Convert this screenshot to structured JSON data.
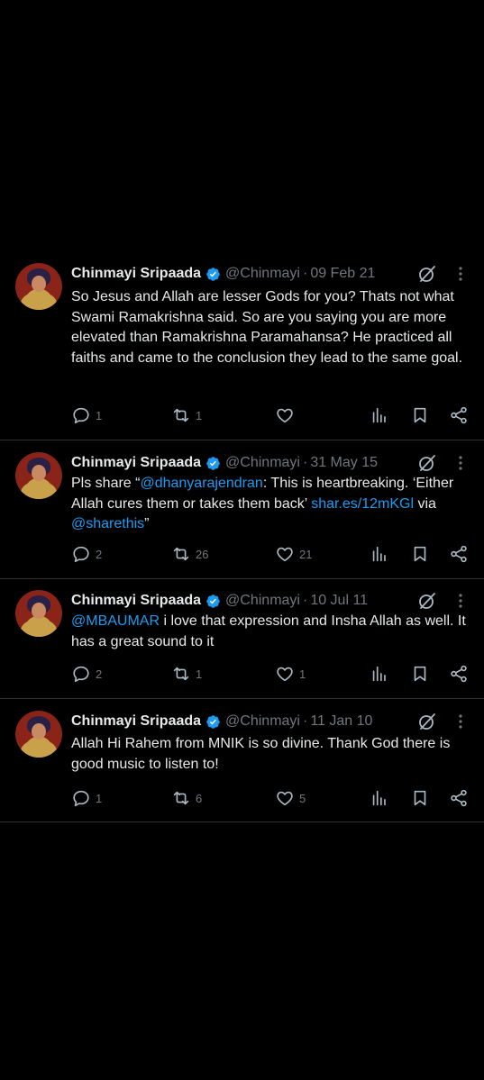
{
  "tweets": [
    {
      "name": "Chinmayi Sripaada",
      "handle": "@Chinmayi",
      "sep": "·",
      "date": "09 Feb 21",
      "text_segments": [
        {
          "t": "So Jesus and Allah are lesser Gods for you? Thats not what Swami Ramakrishna said. So are you saying you are more elevated than Ramakrishna Paramahansa? He practiced all faiths and came to the conclusion they lead to the same goal.",
          "link": false
        }
      ],
      "replies": "1",
      "retweets": "1",
      "likes": ""
    },
    {
      "name": "Chinmayi Sripaada",
      "handle": "@Chinmayi",
      "sep": "·",
      "date": "31 May 15",
      "text_segments": [
        {
          "t": "Pls share “",
          "link": false
        },
        {
          "t": "@dhanyarajendran",
          "link": true
        },
        {
          "t": ": This is heartbreaking. ‘Either Allah cures them or takes them back’ ",
          "link": false
        },
        {
          "t": "shar.es/12mKGl",
          "link": true
        },
        {
          "t": " via ",
          "link": false
        },
        {
          "t": "@sharethis",
          "link": true
        },
        {
          "t": "”",
          "link": false
        }
      ],
      "replies": "2",
      "retweets": "26",
      "likes": "21"
    },
    {
      "name": "Chinmayi Sripaada",
      "handle": "@Chinmayi",
      "sep": "·",
      "date": "10 Jul 11",
      "text_segments": [
        {
          "t": "@MBAUMAR",
          "link": true
        },
        {
          "t": " i love that expression and Insha Allah as well. It has a great sound to it",
          "link": false
        }
      ],
      "replies": "2",
      "retweets": "1",
      "likes": "1"
    },
    {
      "name": "Chinmayi Sripaada",
      "handle": "@Chinmayi",
      "sep": "·",
      "date": "11 Jan 10",
      "text_segments": [
        {
          "t": "Allah Hi Rahem from MNIK is so divine. Thank God there is good music to listen to!",
          "link": false
        }
      ],
      "replies": "1",
      "retweets": "6",
      "likes": "5"
    }
  ],
  "icons": {
    "verified": "verified-badge-icon",
    "grok": "grok-icon",
    "more": "more-icon",
    "reply": "reply-icon",
    "retweet": "retweet-icon",
    "like": "like-icon",
    "views": "views-icon",
    "bookmark": "bookmark-icon",
    "share": "share-icon"
  },
  "colors": {
    "background": "#000000",
    "text": "#e7e9ea",
    "muted": "#71767b",
    "link": "#1d9bf0",
    "divider": "#2f3336"
  }
}
